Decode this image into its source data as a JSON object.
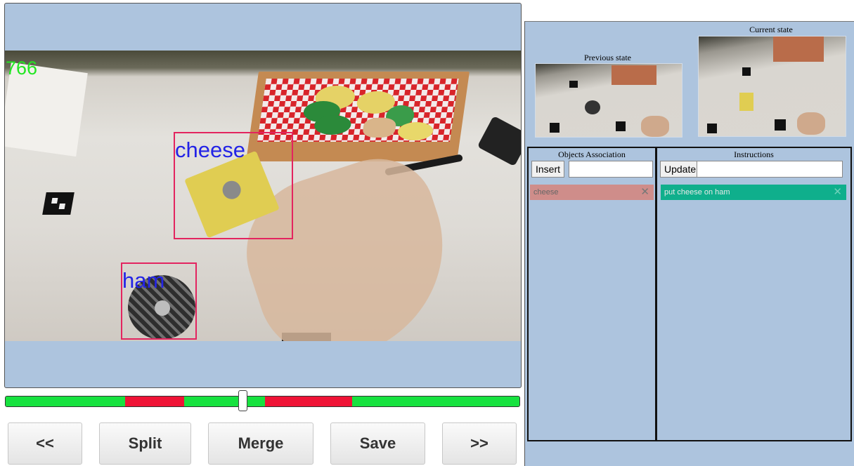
{
  "viewer": {
    "frame_number": "766",
    "detections": [
      {
        "label": "cheese"
      },
      {
        "label": "ham"
      }
    ]
  },
  "timeline": {
    "colors": {
      "ok": "#17e23f",
      "flag": "#ef1336"
    },
    "segments": [
      {
        "state": "ok",
        "start": 0.0,
        "end": 0.232
      },
      {
        "state": "flag",
        "start": 0.232,
        "end": 0.348
      },
      {
        "state": "ok",
        "start": 0.348,
        "end": 0.505
      },
      {
        "state": "flag",
        "start": 0.505,
        "end": 0.675
      },
      {
        "state": "ok",
        "start": 0.675,
        "end": 1.0
      }
    ],
    "position": 0.463
  },
  "buttons": {
    "prev": "<<",
    "split": "Split",
    "merge": "Merge",
    "save": "Save",
    "next": ">>"
  },
  "panel": {
    "previous_state_label": "Previous state",
    "current_state_label": "Current state",
    "objects": {
      "title": "Objects Association",
      "insert_label": "Insert",
      "input_value": "",
      "items": [
        {
          "label": "cheese",
          "color": "#cf8d8a"
        }
      ]
    },
    "instructions": {
      "title": "Instructions",
      "update_label": "Update",
      "input_value": "",
      "items": [
        {
          "label": "put cheese on ham",
          "color": "#0faf8c"
        }
      ]
    }
  }
}
